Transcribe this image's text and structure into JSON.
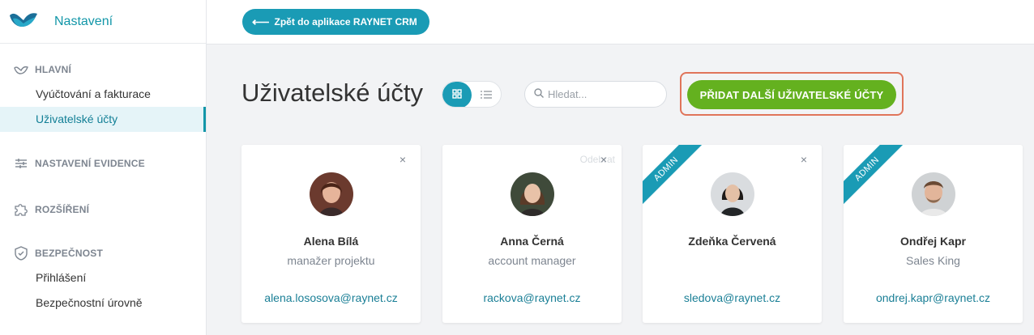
{
  "sidebar": {
    "title": "Nastavení",
    "sections": [
      {
        "label": "HLAVNÍ",
        "icon": "cloud-logo-icon",
        "items": [
          {
            "label": "Vyúčtování a fakturace"
          },
          {
            "label": "Uživatelské účty",
            "active": true
          }
        ]
      },
      {
        "label": "NASTAVENÍ EVIDENCE",
        "icon": "sliders-icon",
        "items": []
      },
      {
        "label": "ROZŠÍŘENÍ",
        "icon": "puzzle-icon",
        "items": []
      },
      {
        "label": "BEZPEČNOST",
        "icon": "shield-icon",
        "items": [
          {
            "label": "Přihlášení"
          },
          {
            "label": "Bezpečnostní úrovně"
          }
        ]
      }
    ]
  },
  "topbar": {
    "back_label": "Zpět do aplikace RAYNET CRM"
  },
  "header": {
    "title": "Uživatelské účty",
    "search_placeholder": "Hledat...",
    "add_label": "PŘIDAT DALŠÍ UŽIVATELSKÉ ÚČTY"
  },
  "cards": [
    {
      "name": "Alena Bílá",
      "role": "manažer projektu",
      "email": "alena.lososova@raynet.cz",
      "admin": false,
      "close": "×"
    },
    {
      "name": "Anna Černá",
      "role": "account manager",
      "email": "rackova@raynet.cz",
      "admin": false,
      "close": "×",
      "ghost": "Odebrat"
    },
    {
      "name": "Zdeňka Červená",
      "role": "",
      "email": "sledova@raynet.cz",
      "admin": true,
      "badge": "ADMIN",
      "close": "×"
    },
    {
      "name": "Ondřej Kapr",
      "role": "Sales King",
      "email": "ondrej.kapr@raynet.cz",
      "admin": true,
      "badge": "ADMIN"
    }
  ],
  "colors": {
    "accent": "#1a9bb5",
    "primary_action": "#64b11f",
    "highlight_border": "#e0745a"
  }
}
